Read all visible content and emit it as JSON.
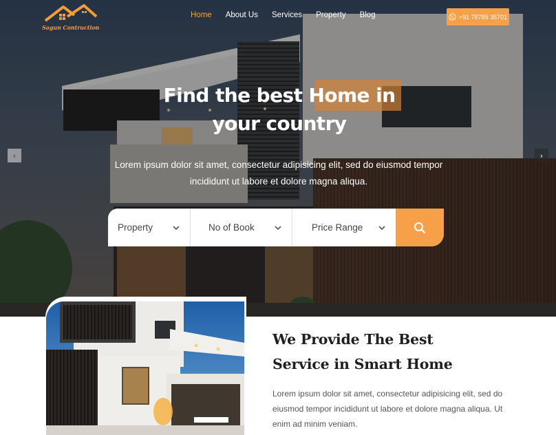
{
  "brand": {
    "logo_text": "Sagun Contruction"
  },
  "nav": {
    "items": [
      {
        "label": "Home",
        "active": true
      },
      {
        "label": "About Us",
        "active": false
      },
      {
        "label": "Services",
        "active": false
      },
      {
        "label": "Property",
        "active": false
      },
      {
        "label": "Blog",
        "active": false
      }
    ],
    "phone": "+91 78785 35701",
    "phone_icon": "whatsapp-icon"
  },
  "hero": {
    "headline_line1": "Find the best Home in",
    "headline_line2": "your country",
    "subtext": "Lorem ipsum dolor sit amet, consectetur adipisicing elit, sed do eiusmod tempor incididunt ut labore et dolore magna aliqua.",
    "prev_arrow": "‹",
    "next_arrow": "›"
  },
  "search": {
    "fields": [
      {
        "label": "Property"
      },
      {
        "label": "No of Book"
      },
      {
        "label": "Price Range"
      }
    ],
    "button_icon": "search-icon"
  },
  "service_section": {
    "title_line1": "We Provide The Best",
    "title_line2": "Service in Smart Home",
    "text": "Lorem ipsum dolor sit amet, consectetur adipisicing elit, sed do eiusmod tempor incididunt ut labore et dolore magna aliqua. Ut enim ad minim veniam."
  },
  "colors": {
    "accent": "#f7a04a",
    "active_nav": "#f4a24c",
    "title": "#1f1f1f",
    "body_text": "#555555"
  }
}
